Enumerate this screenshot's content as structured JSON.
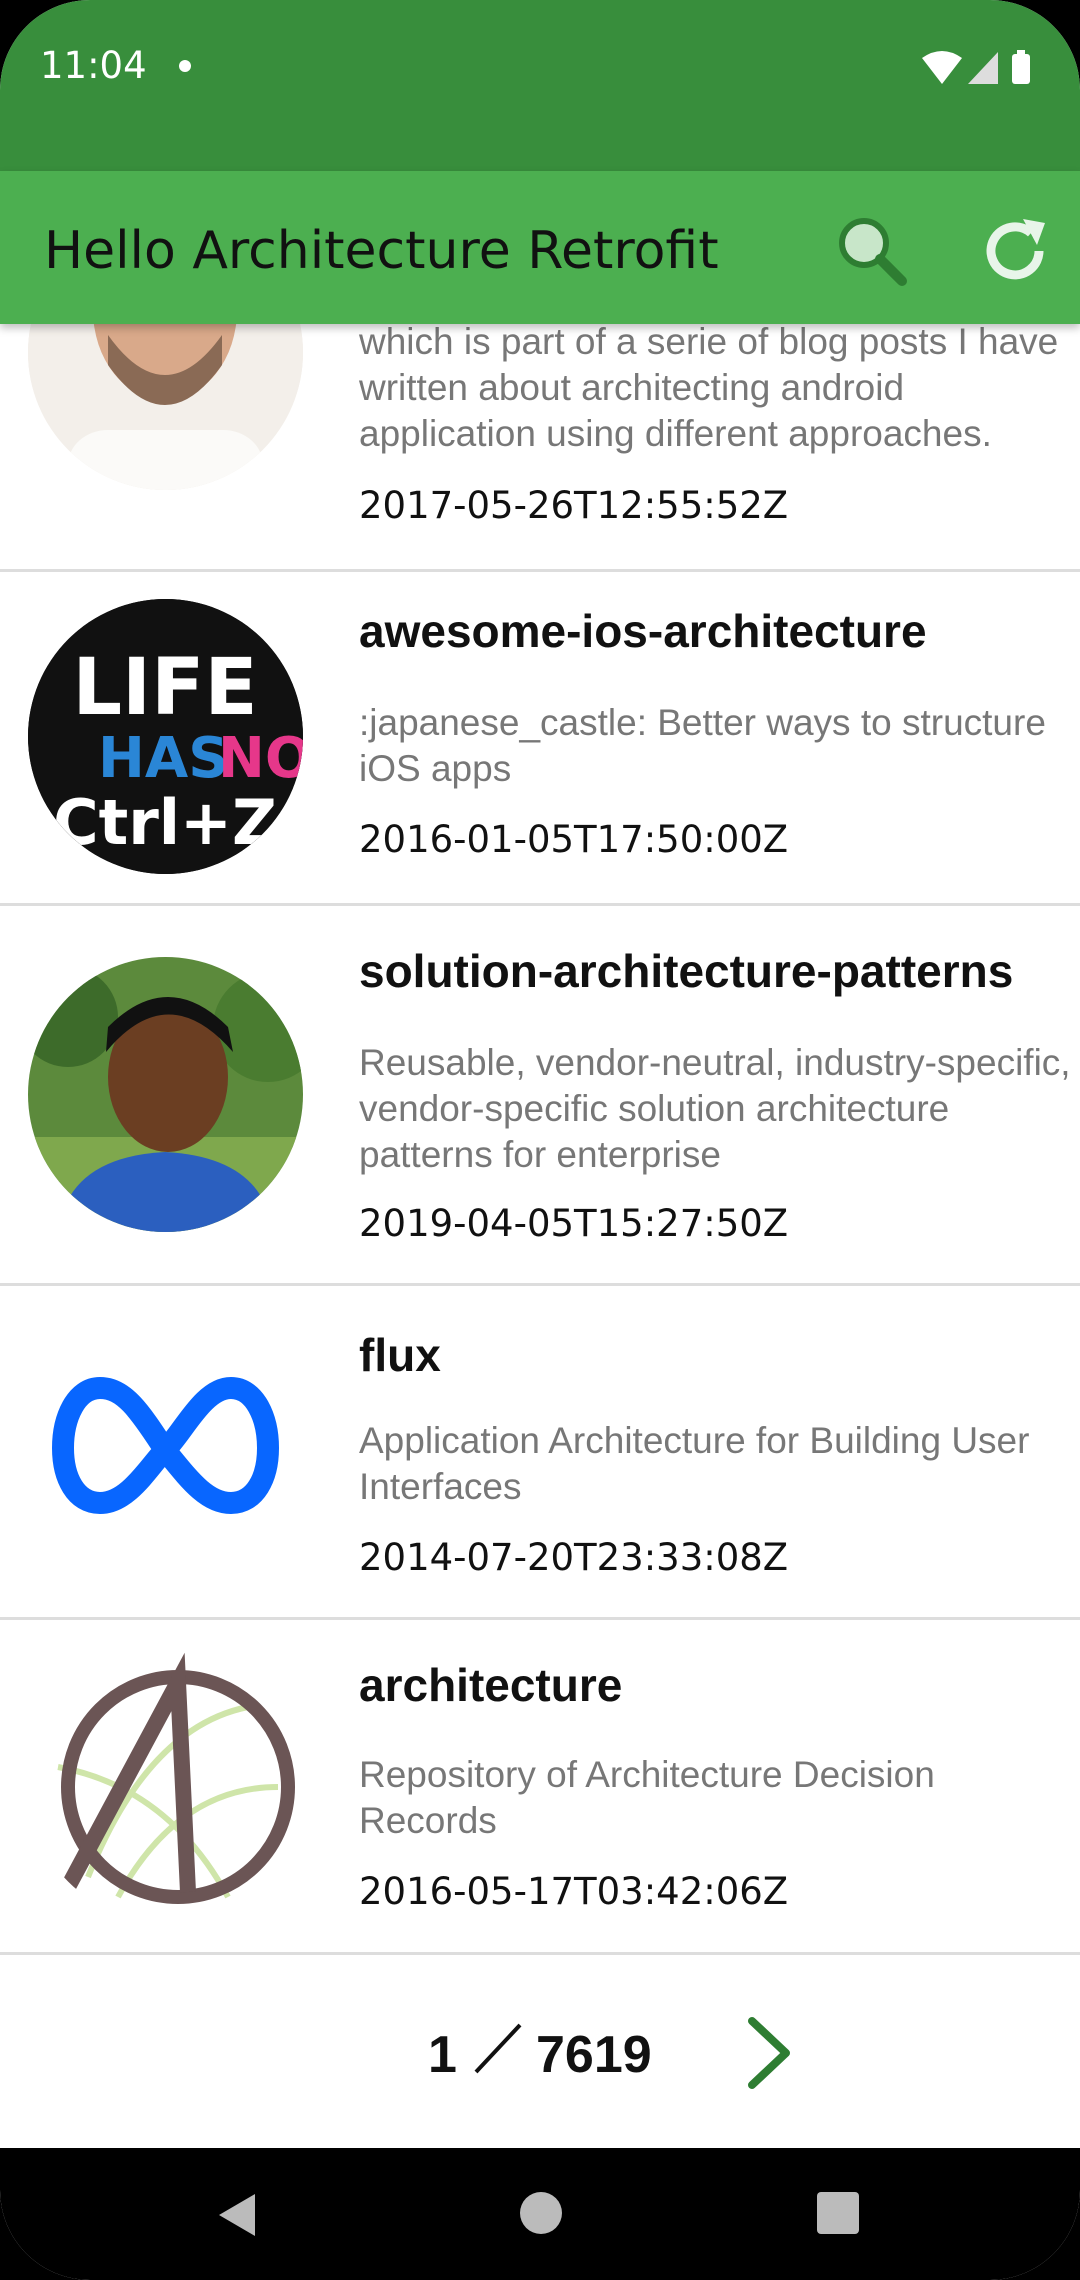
{
  "status_bar": {
    "time": "11:04",
    "icons": [
      "wifi-icon",
      "signal-icon",
      "battery-icon"
    ]
  },
  "app_bar": {
    "title": "Hello Architecture Retrofit",
    "actions": [
      "search-icon",
      "refresh-icon"
    ],
    "color": "#4CAF50",
    "status_color": "#388E3C"
  },
  "repos": [
    {
      "name": "",
      "description": "which is part of a serie of blog posts I have written about architecting android application using different approaches.",
      "date": "2017-05-26T12:55:52Z"
    },
    {
      "name": "awesome-ios-architecture",
      "description": ":japanese_castle: Better ways to structure iOS apps",
      "date": "2016-01-05T17:50:00Z",
      "avatar_text": {
        "line1": "LIFE",
        "line2a": "HAS",
        "line2b": "NO",
        "line3": "Ctrl+Z"
      }
    },
    {
      "name": "solution-architecture-patterns",
      "description": "Reusable, vendor-neutral, industry-specific, vendor-specific solution architecture patterns for enterprise",
      "date": "2019-04-05T15:27:50Z"
    },
    {
      "name": "flux",
      "description": "Application Architecture for Building User Interfaces",
      "date": "2014-07-20T23:33:08Z"
    },
    {
      "name": "architecture",
      "description": "Repository of Architecture Decision Records",
      "date": "2016-05-17T03:42:06Z"
    }
  ],
  "pagination": {
    "current": "1",
    "total": "7619",
    "next_icon": "chevron-right-icon"
  },
  "nav_bar": {
    "buttons": [
      "back-icon",
      "home-icon",
      "recents-icon"
    ]
  }
}
